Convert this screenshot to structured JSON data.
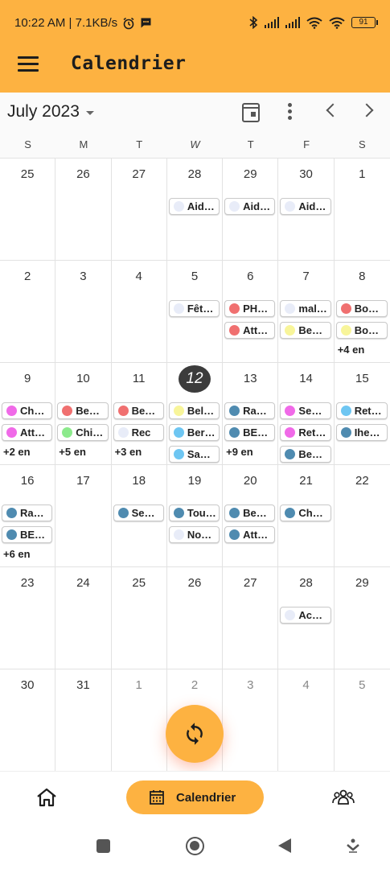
{
  "status_bar": {
    "time_speed": "10:22 AM | 7.1KB/s",
    "battery": "91",
    "icons": [
      "alarm-icon",
      "message-icon",
      "bluetooth-icon",
      "signal-icon",
      "signal-icon",
      "wifi-icon",
      "wifi-icon",
      "battery-icon"
    ]
  },
  "app_bar": {
    "title": "Calendrier",
    "menu_icon": "hamburger-menu-icon"
  },
  "calendar_header": {
    "month_label": "July 2023",
    "icons": [
      "calendar-today-icon",
      "more-vert-icon",
      "chevron-left-icon",
      "chevron-right-icon"
    ]
  },
  "weekdays": [
    "S",
    "M",
    "T",
    "W",
    "T",
    "F",
    "S"
  ],
  "weeks": [
    [
      {
        "num": "25",
        "muted": false,
        "events": []
      },
      {
        "num": "26",
        "muted": false,
        "events": []
      },
      {
        "num": "27",
        "muted": false,
        "events": []
      },
      {
        "num": "28",
        "muted": false,
        "events": [
          {
            "label": "Aid…",
            "color": "#e8ecf8"
          }
        ]
      },
      {
        "num": "29",
        "muted": false,
        "events": [
          {
            "label": "Aid…",
            "color": "#e8ecf8"
          }
        ]
      },
      {
        "num": "30",
        "muted": false,
        "events": [
          {
            "label": "Aid…",
            "color": "#e8ecf8"
          }
        ]
      },
      {
        "num": "1",
        "muted": false,
        "events": []
      }
    ],
    [
      {
        "num": "2",
        "muted": false,
        "events": []
      },
      {
        "num": "3",
        "muted": false,
        "events": []
      },
      {
        "num": "4",
        "muted": false,
        "events": []
      },
      {
        "num": "5",
        "muted": false,
        "events": [
          {
            "label": "Fêt…",
            "color": "#e8ecf8"
          }
        ]
      },
      {
        "num": "6",
        "muted": false,
        "events": [
          {
            "label": "PH…",
            "color": "#f07070"
          },
          {
            "label": "Att…",
            "color": "#f07070"
          }
        ]
      },
      {
        "num": "7",
        "muted": false,
        "events": [
          {
            "label": "mal…",
            "color": "#e8ecf8"
          },
          {
            "label": "Be…",
            "color": "#f8f59a"
          }
        ]
      },
      {
        "num": "8",
        "muted": false,
        "events": [
          {
            "label": "Bo…",
            "color": "#f07070"
          },
          {
            "label": "Bo…",
            "color": "#f8f59a"
          }
        ],
        "more": "+4 en"
      }
    ],
    [
      {
        "num": "9",
        "muted": false,
        "events": [
          {
            "label": "Cha…",
            "color": "#f06ae8"
          },
          {
            "label": "Att…",
            "color": "#f06ae8"
          }
        ],
        "more": "+2 en"
      },
      {
        "num": "10",
        "muted": false,
        "events": [
          {
            "label": "Be…",
            "color": "#f07070"
          },
          {
            "label": "Chil…",
            "color": "#8cea8c"
          }
        ],
        "more": "+5 en"
      },
      {
        "num": "11",
        "muted": false,
        "events": [
          {
            "label": "Be…",
            "color": "#f07070"
          },
          {
            "label": "Rec",
            "color": "#e8ecf8"
          }
        ],
        "more": "+3 en"
      },
      {
        "num": "12",
        "muted": false,
        "today": true,
        "events": [
          {
            "label": "Bel…",
            "color": "#f8f59a"
          },
          {
            "label": "Ber…",
            "color": "#6ec6f2"
          },
          {
            "label": "Sah…",
            "color": "#6ec6f2"
          }
        ]
      },
      {
        "num": "13",
        "muted": false,
        "events": [
          {
            "label": "Ra…",
            "color": "#4f8bb0"
          },
          {
            "label": "BE…",
            "color": "#4f8bb0"
          }
        ],
        "more": "+9 en"
      },
      {
        "num": "14",
        "muted": false,
        "events": [
          {
            "label": "Sen…",
            "color": "#f06ae8"
          },
          {
            "label": "Ret…",
            "color": "#f06ae8"
          },
          {
            "label": "Be…",
            "color": "#4f8bb0"
          }
        ]
      },
      {
        "num": "15",
        "muted": false,
        "events": [
          {
            "label": "Ret…",
            "color": "#6ec6f2"
          },
          {
            "label": "Ihe…",
            "color": "#4f8bb0"
          }
        ]
      }
    ],
    [
      {
        "num": "16",
        "muted": false,
        "events": [
          {
            "label": "Ra…",
            "color": "#4f8bb0"
          },
          {
            "label": "BE…",
            "color": "#4f8bb0"
          }
        ],
        "more": "+6 en"
      },
      {
        "num": "17",
        "muted": false,
        "events": []
      },
      {
        "num": "18",
        "muted": false,
        "events": [
          {
            "label": "Sen…",
            "color": "#4f8bb0"
          }
        ]
      },
      {
        "num": "19",
        "muted": false,
        "events": [
          {
            "label": "Tou…",
            "color": "#4f8bb0"
          },
          {
            "label": "No…",
            "color": "#e8ecf8"
          }
        ]
      },
      {
        "num": "20",
        "muted": false,
        "events": [
          {
            "label": "Be…",
            "color": "#4f8bb0"
          },
          {
            "label": "Att…",
            "color": "#4f8bb0"
          }
        ]
      },
      {
        "num": "21",
        "muted": false,
        "events": [
          {
            "label": "Cha…",
            "color": "#4f8bb0"
          }
        ]
      },
      {
        "num": "22",
        "muted": false,
        "events": []
      }
    ],
    [
      {
        "num": "23",
        "muted": false,
        "events": []
      },
      {
        "num": "24",
        "muted": false,
        "events": []
      },
      {
        "num": "25",
        "muted": false,
        "events": []
      },
      {
        "num": "26",
        "muted": false,
        "events": []
      },
      {
        "num": "27",
        "muted": false,
        "events": []
      },
      {
        "num": "28",
        "muted": false,
        "events": [
          {
            "label": "Ac…",
            "color": "#e8ecf8"
          }
        ]
      },
      {
        "num": "29",
        "muted": false,
        "events": []
      }
    ],
    [
      {
        "num": "30",
        "muted": false,
        "events": []
      },
      {
        "num": "31",
        "muted": false,
        "events": []
      },
      {
        "num": "1",
        "muted": true,
        "events": []
      },
      {
        "num": "2",
        "muted": true,
        "events": []
      },
      {
        "num": "3",
        "muted": true,
        "events": []
      },
      {
        "num": "4",
        "muted": true,
        "events": []
      },
      {
        "num": "5",
        "muted": true,
        "events": []
      }
    ]
  ],
  "fab": {
    "icon": "sync-icon"
  },
  "bottom_nav": {
    "home_icon": "home-icon",
    "calendar_label": "Calendrier",
    "calendar_icon": "calendar-icon",
    "group_icon": "group-icon"
  },
  "system_nav": {
    "icons": [
      "recents-icon",
      "home-icon",
      "back-icon",
      "down-icon"
    ]
  },
  "colors": {
    "accent": "#fdb241",
    "today": "#3c3c3c"
  }
}
